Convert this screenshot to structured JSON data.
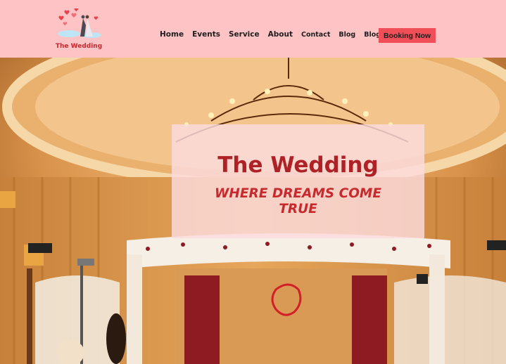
{
  "brand": {
    "name": "The Wedding"
  },
  "nav": {
    "items": [
      "Home",
      "Events",
      "Service",
      "About",
      "Contact",
      "Blog",
      "Blog Article"
    ],
    "cta": "Booking Now"
  },
  "hero": {
    "title": "The Wedding",
    "subtitle": "WHERE DREAMS COME TRUE"
  },
  "colors": {
    "header_bg": "#fdc3c5",
    "accent": "#f04f57",
    "title": "#ad2127"
  }
}
